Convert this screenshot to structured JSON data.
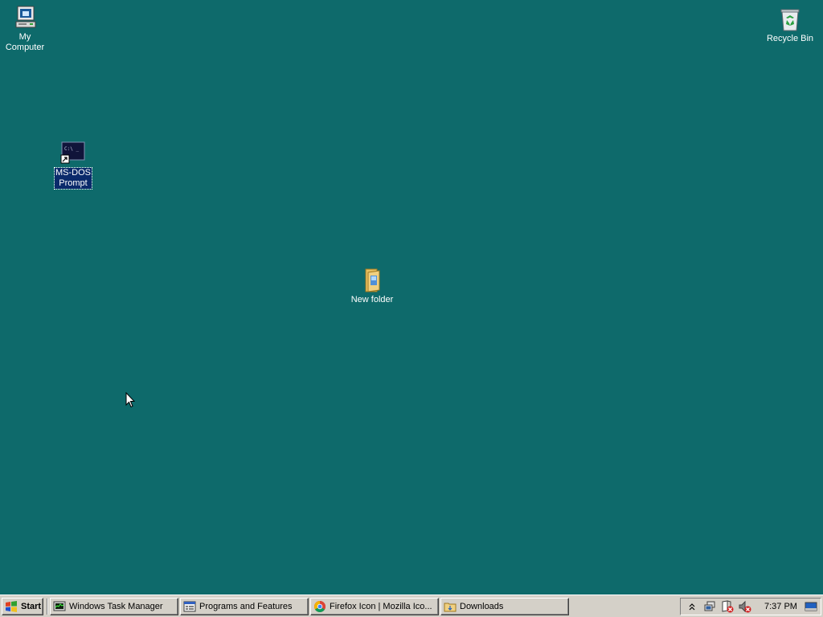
{
  "desktop": {
    "background_color": "#0e6a6b",
    "icons": {
      "my_computer": "My Computer",
      "recycle_bin": "Recycle Bin",
      "msdos_prompt": "MS-DOS\nPrompt",
      "new_folder": "New folder"
    },
    "selected_icon": "MS-DOS Prompt"
  },
  "taskbar": {
    "start_label": "Start",
    "tasks": [
      {
        "label": "Windows Task Manager",
        "icon": "task-manager-icon"
      },
      {
        "label": "Programs and Features",
        "icon": "programs-features-icon"
      },
      {
        "label": "Firefox Icon | Mozilla Ico...",
        "icon": "chrome-icon"
      },
      {
        "label": "Downloads",
        "icon": "folder-icon"
      }
    ],
    "tray": {
      "clock": "7:37 PM",
      "icons": [
        "show-hidden-icons-chevron",
        "network-icon",
        "action-center-warning-icon",
        "volume-muted-icon",
        "show-desktop-icon"
      ]
    }
  }
}
